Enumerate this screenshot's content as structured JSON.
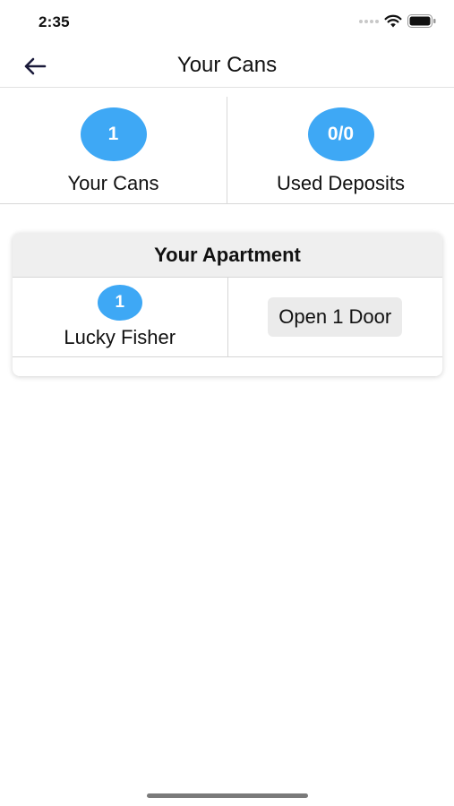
{
  "status_bar": {
    "time": "2:35"
  },
  "header": {
    "title": "Your Cans",
    "back_icon": "arrow-left-icon"
  },
  "stats": [
    {
      "value": "1",
      "label": "Your Cans"
    },
    {
      "value": "0/0",
      "label": "Used Deposits"
    }
  ],
  "apartment": {
    "title": "Your Apartment",
    "member": {
      "count": "1",
      "name": "Lucky Fisher"
    },
    "open_door_label": "Open 1 Door"
  },
  "colors": {
    "accent": "#3ea8f5",
    "card_header_bg": "#efefef",
    "button_bg": "#ebebeb"
  }
}
